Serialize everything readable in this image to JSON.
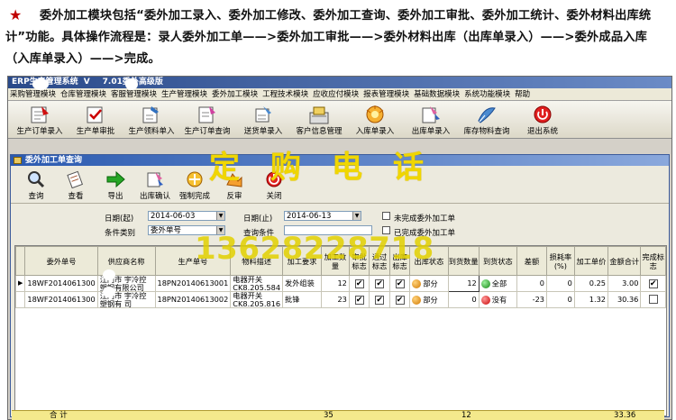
{
  "intro": {
    "star": "★",
    "text": "委外加工模块包括“委外加工录入、委外加工修改、委外加工查询、委外加工审批、委外加工统计、委外材料出库统计”功能。具体操作流程是：录人委外加工单——>委外加工审批——>委外材料出库（出库单录入）——>委外成品入库（入库单录入）——>完成。"
  },
  "app": {
    "title_left": "ERP生产管理系统",
    "title_mid": "V",
    "title_ver": "7.01委外高级版",
    "menu": [
      "采购管理模块",
      "仓库管理模块",
      "客服管理模块",
      "生产管理模块",
      "委外加工模块",
      "工程技术模块",
      "应收应付模块",
      "报表管理模块",
      "基础数据模块",
      "系统功能模块",
      "帮助"
    ],
    "toolbar": [
      {
        "label": "生产订单录入",
        "icon": "order-entry-icon"
      },
      {
        "label": "生产单审批",
        "icon": "approve-icon"
      },
      {
        "label": "生产领料单入",
        "icon": "material-pick-icon"
      },
      {
        "label": "生产订单查询",
        "icon": "order-query-icon"
      },
      {
        "label": "送货单录入",
        "icon": "delivery-icon"
      },
      {
        "label": "客户信息管理",
        "icon": "customer-icon"
      },
      {
        "label": "入库单录入",
        "icon": "inbound-icon"
      },
      {
        "label": "出库单录入",
        "icon": "outbound-icon"
      },
      {
        "label": "库存物料查询",
        "icon": "inventory-icon"
      },
      {
        "label": "退出系统",
        "icon": "exit-icon"
      }
    ]
  },
  "window": {
    "title": "委外加工单查询",
    "toolbar": [
      {
        "label": "查询"
      },
      {
        "label": "查看"
      },
      {
        "label": "导出"
      },
      {
        "label": "出库确认"
      },
      {
        "label": "强制完成"
      },
      {
        "label": "反审"
      },
      {
        "label": "关闭"
      }
    ],
    "filter": {
      "date_from_label": "日期(起)",
      "date_from": "2014-06-03",
      "date_to_label": "日期(止)",
      "date_to": "2014-06-13",
      "cond_type_label": "条件类别",
      "cond_type": "委外单号",
      "cond_value_label": "查询条件",
      "unfinished_label": "未完成委外加工单",
      "finished_label": "已完成委外加工单"
    },
    "columns": [
      "委外单号",
      "供应商名称",
      "生产单号",
      "物料描述",
      "加工要求",
      "加工数量",
      "审批标志",
      "通过标志",
      "出库标志",
      "出库状态",
      "到货数量",
      "到货状态",
      "差额",
      "损耗率(%)",
      "加工单价",
      "金额合计",
      "完成标志"
    ],
    "rows": [
      {
        "order_no": "18WF2014061300",
        "supplier": "江门市  宇冷控塑钢有限公司",
        "prod_no": "18PN20140613001",
        "material": "电器开关 CK8.205.584",
        "requirement": "发外组装",
        "qty": "12",
        "approved": true,
        "passed": true,
        "outbound": true,
        "out_status": "部分",
        "recv_qty": "12",
        "recv_status": "全部",
        "diff": "0",
        "loss": "0",
        "price": "0.25",
        "amount": "3.00",
        "done": true
      },
      {
        "order_no": "18WF2014061300",
        "supplier": "江门市  宇冷控塑钢有  司",
        "prod_no": "18PN20140613002",
        "material": "电器开关 CK8.205.816",
        "requirement": "批锋",
        "qty": "23",
        "approved": true,
        "passed": true,
        "outbound": true,
        "out_status": "部分",
        "recv_qty": "0",
        "recv_status": "没有",
        "diff": "-23",
        "loss": "0",
        "price": "1.32",
        "amount": "30.36",
        "done": false
      }
    ],
    "total": {
      "label": "合 计",
      "qty": "35",
      "recv_qty": "12",
      "amount": "33.36"
    }
  },
  "watermark": {
    "line1": "定购电话",
    "line2": "13628228718"
  }
}
